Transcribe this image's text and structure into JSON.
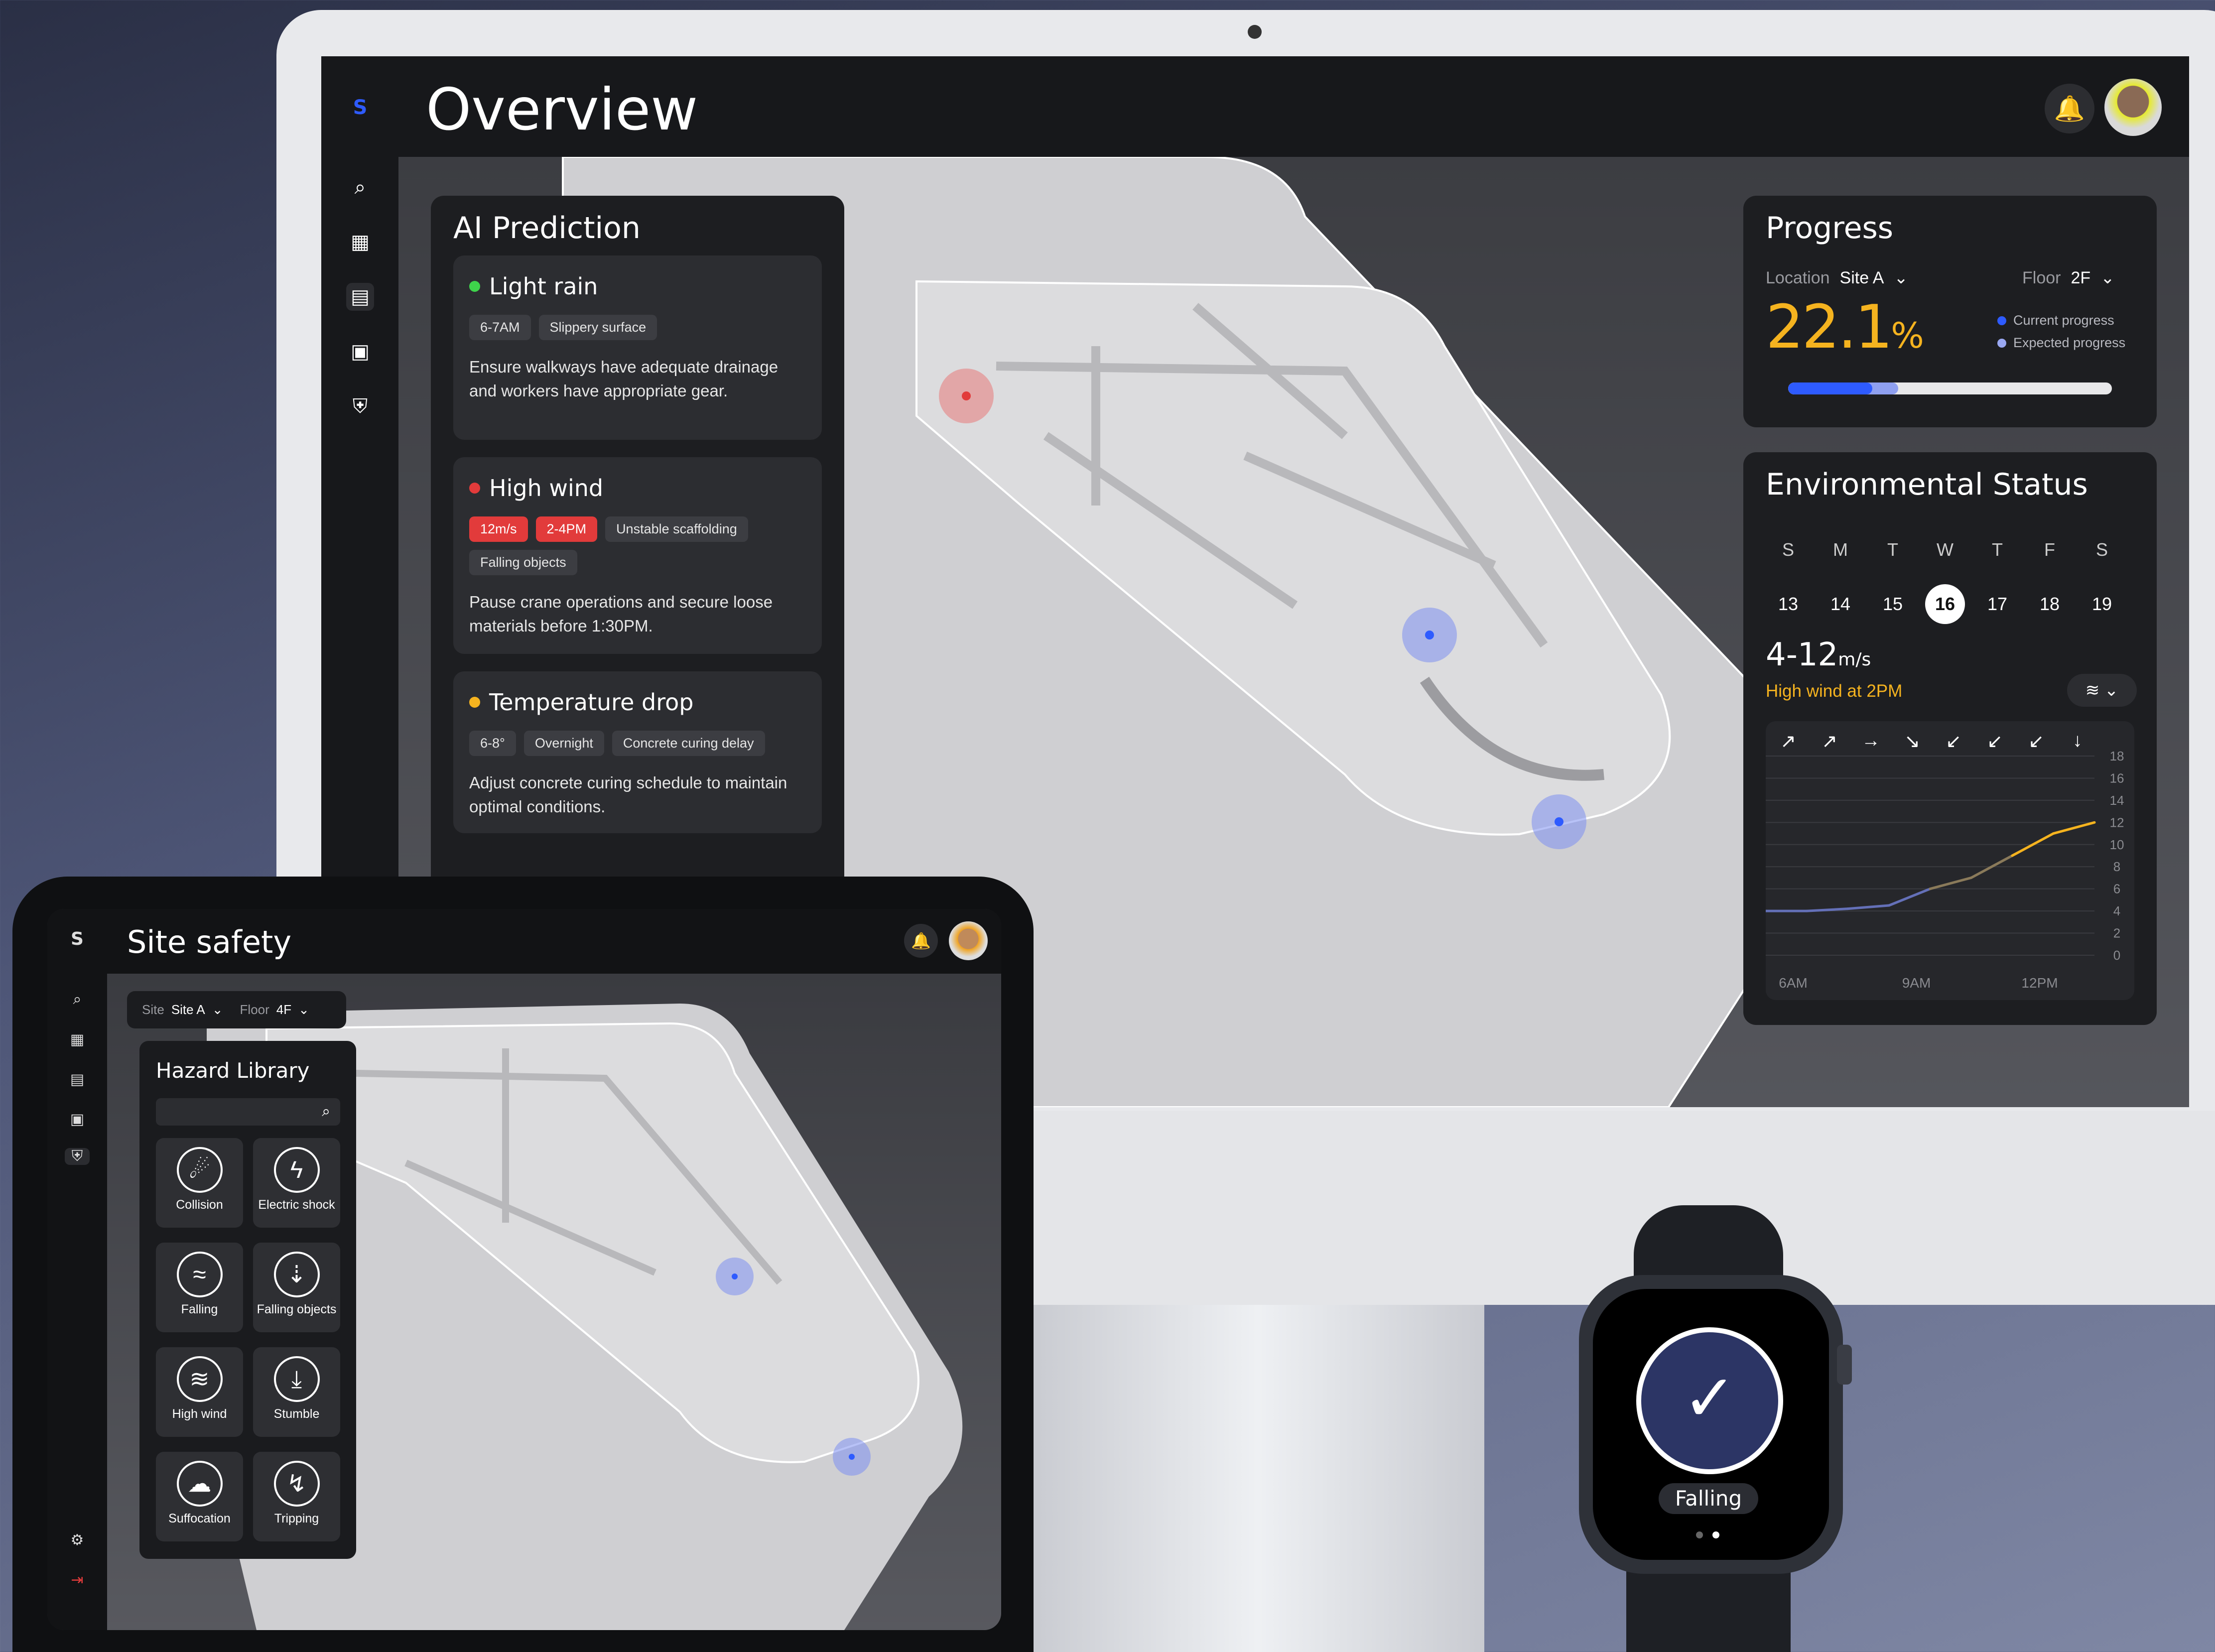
{
  "desktop": {
    "logo": "S",
    "title": "Overview",
    "ai": {
      "title": "AI Prediction",
      "items": [
        {
          "title": "Light rain",
          "color": "#3ed34b",
          "tags": [
            "6-7AM",
            "Slippery surface"
          ],
          "red_tags": [],
          "desc": "Ensure walkways have adequate drainage and workers have appropriate gear."
        },
        {
          "title": "High wind",
          "color": "#e23b3b",
          "tags": [
            "Unstable scaffolding",
            "Falling objects"
          ],
          "red_tags": [
            "12m/s",
            "2-4PM"
          ],
          "desc": "Pause crane operations and secure loose materials before 1:30PM."
        },
        {
          "title": "Temperature drop",
          "color": "#f5b31f",
          "tags": [
            "6-8°",
            "Overnight",
            "Concrete curing delay"
          ],
          "red_tags": [],
          "desc": "Adjust concrete curing schedule to maintain optimal conditions."
        }
      ]
    },
    "progress": {
      "title": "Progress",
      "location_label": "Location",
      "location_value": "Site A",
      "floor_label": "Floor",
      "floor_value": "2F",
      "percent": "22.1",
      "percent_unit": "%",
      "legend_current": "Current progress",
      "legend_expected": "Expected progress",
      "current_fraction": 0.26,
      "expected_fraction": 0.34
    },
    "env": {
      "title": "Environmental Status",
      "days": [
        "S",
        "M",
        "T",
        "W",
        "T",
        "F",
        "S"
      ],
      "dates": [
        "13",
        "14",
        "15",
        "16",
        "17",
        "18",
        "19"
      ],
      "selected_date": "16",
      "wind": "4-12",
      "wind_unit": "m/s",
      "alert": "High wind at 2PM",
      "directions": [
        "↗",
        "↗",
        "→",
        "↘",
        "↙",
        "↙",
        "↙",
        "↓"
      ]
    }
  },
  "chart_data": {
    "type": "line",
    "x": [
      "6AM",
      "7AM",
      "8AM",
      "9AM",
      "10AM",
      "11AM",
      "12PM",
      "1PM",
      "2PM"
    ],
    "y": [
      4,
      4,
      4.2,
      4.5,
      6,
      7,
      9,
      11,
      12
    ],
    "xticks": [
      "6AM",
      "9AM",
      "12PM"
    ],
    "yticks": [
      "18",
      "16",
      "14",
      "12",
      "10",
      "8",
      "6",
      "4",
      "2",
      "0"
    ],
    "ylim": [
      0,
      18
    ]
  },
  "tablet": {
    "logo": "S",
    "title": "Site safety",
    "site_label": "Site",
    "site_value": "Site A",
    "floor_label": "Floor",
    "floor_value": "4F",
    "hazard": {
      "title": "Hazard Library",
      "items": [
        "Collision",
        "Electric shock",
        "Falling",
        "Falling objects",
        "High wind",
        "Stumble",
        "Suffocation",
        "Tripping"
      ]
    }
  },
  "watch": {
    "label": "Falling"
  },
  "colors": {
    "accent": "#2e5bff",
    "warning": "#f5b31f",
    "danger": "#e23b3b"
  }
}
